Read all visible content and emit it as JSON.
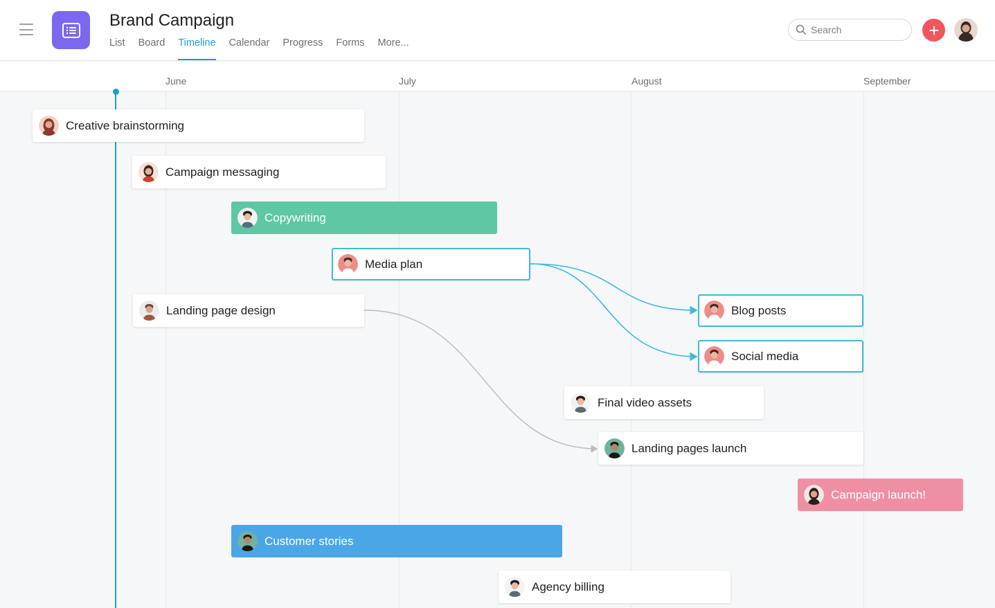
{
  "header": {
    "title": "Brand Campaign",
    "tabs": [
      {
        "label": "List",
        "active": false
      },
      {
        "label": "Board",
        "active": false
      },
      {
        "label": "Timeline",
        "active": true
      },
      {
        "label": "Calendar",
        "active": false
      },
      {
        "label": "Progress",
        "active": false
      },
      {
        "label": "Forms",
        "active": false
      },
      {
        "label": "More..."
      }
    ],
    "search_placeholder": "Search",
    "add_icon": "plus-icon",
    "accent_color": "#1a9fcd",
    "brand_color": "#7b68ee"
  },
  "timeline": {
    "months": [
      "June",
      "July",
      "August",
      "September"
    ],
    "tasks": [
      {
        "label": "Creative brainstorming",
        "style": "plain"
      },
      {
        "label": "Campaign messaging",
        "style": "plain"
      },
      {
        "label": "Copywriting",
        "style": "green",
        "color": "#5ec7a4"
      },
      {
        "label": "Media plan",
        "style": "outlined"
      },
      {
        "label": "Landing page design",
        "style": "plain"
      },
      {
        "label": "Blog posts",
        "style": "outlined"
      },
      {
        "label": "Social media",
        "style": "outlined"
      },
      {
        "label": "Final video assets",
        "style": "plain"
      },
      {
        "label": "Landing pages launch",
        "style": "plain"
      },
      {
        "label": "Campaign launch!",
        "style": "pink",
        "color": "#ef8fa4"
      },
      {
        "label": "Customer stories",
        "style": "blue",
        "color": "#4ba6e8"
      },
      {
        "label": "Agency billing",
        "style": "plain"
      }
    ],
    "dependencies": [
      {
        "from": "Media plan",
        "to": "Blog posts"
      },
      {
        "from": "Media plan",
        "to": "Social media"
      },
      {
        "from": "Landing page design",
        "to": "Landing pages launch"
      }
    ]
  }
}
